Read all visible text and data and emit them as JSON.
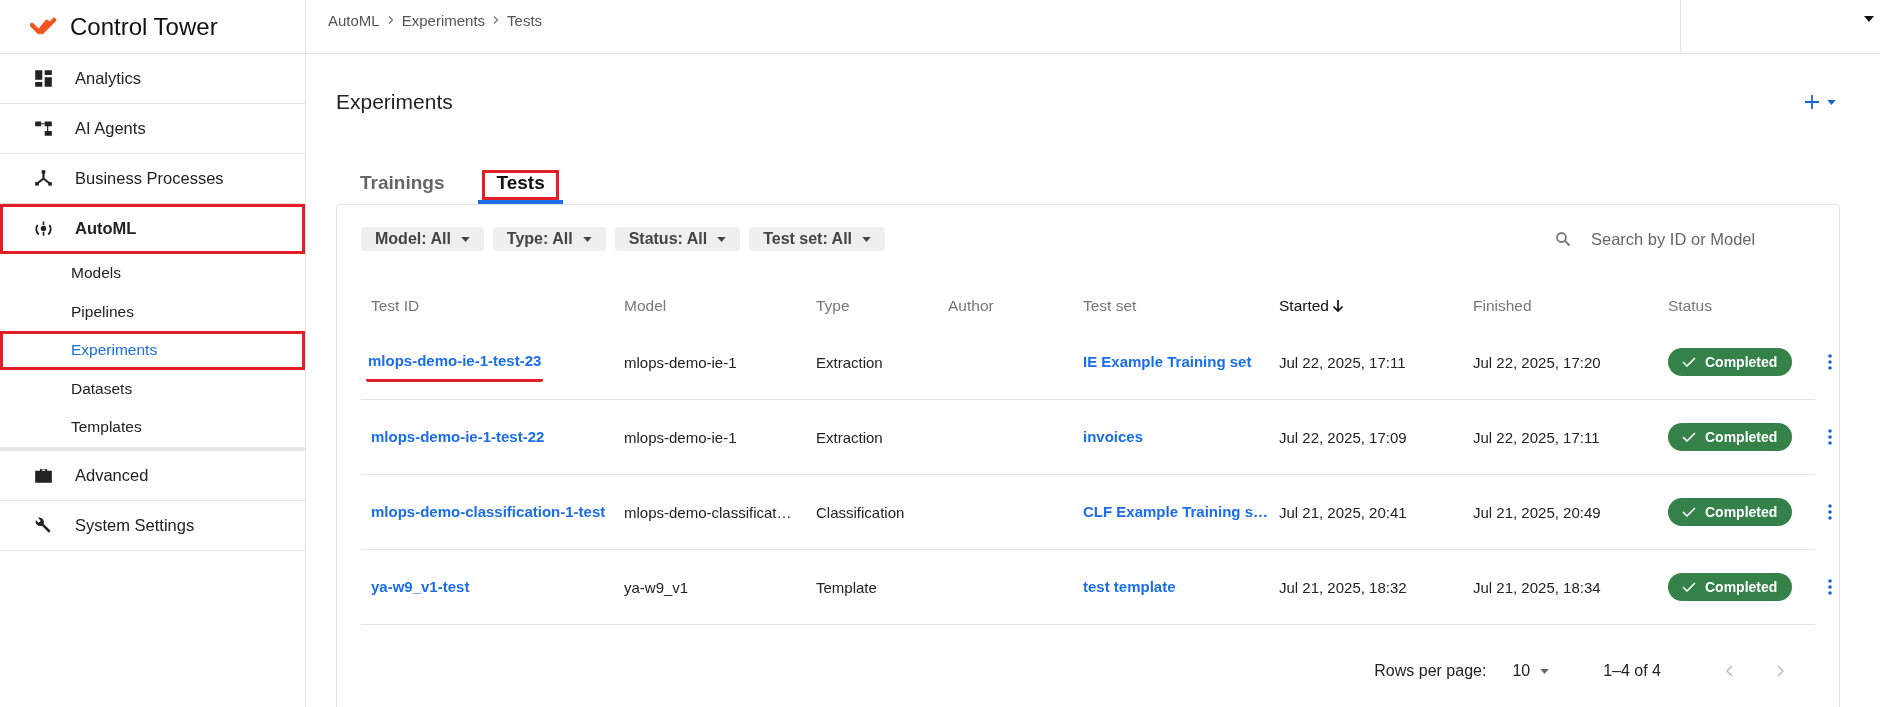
{
  "app": {
    "title": "Control Tower"
  },
  "sidebar": {
    "items": [
      {
        "label": "Analytics",
        "selected": false,
        "highlighted": false
      },
      {
        "label": "AI Agents",
        "selected": false,
        "highlighted": false
      },
      {
        "label": "Business Processes",
        "selected": false,
        "highlighted": false
      },
      {
        "label": "AutoML",
        "selected": true,
        "highlighted": true,
        "children": [
          {
            "label": "Models",
            "selected": false,
            "highlighted": false
          },
          {
            "label": "Pipelines",
            "selected": false,
            "highlighted": false
          },
          {
            "label": "Experiments",
            "selected": true,
            "highlighted": true
          },
          {
            "label": "Datasets",
            "selected": false,
            "highlighted": false
          },
          {
            "label": "Templates",
            "selected": false,
            "highlighted": false
          }
        ]
      },
      {
        "label": "Advanced",
        "selected": false,
        "highlighted": false
      },
      {
        "label": "System Settings",
        "selected": false,
        "highlighted": false
      }
    ]
  },
  "breadcrumbs": [
    "AutoML",
    "Experiments",
    "Tests"
  ],
  "page": {
    "title": "Experiments"
  },
  "tabs": [
    {
      "label": "Trainings",
      "selected": false,
      "highlighted": false
    },
    {
      "label": "Tests",
      "selected": true,
      "highlighted": true
    }
  ],
  "filters": [
    "Model: All",
    "Type: All",
    "Status: All",
    "Test set: All"
  ],
  "search": {
    "placeholder": "Search by ID or Model"
  },
  "table": {
    "columns": [
      {
        "label": "Test ID",
        "sorted": false
      },
      {
        "label": "Model",
        "sorted": false
      },
      {
        "label": "Type",
        "sorted": false
      },
      {
        "label": "Author",
        "sorted": false
      },
      {
        "label": "Test set",
        "sorted": false
      },
      {
        "label": "Started",
        "sorted": true
      },
      {
        "label": "Finished",
        "sorted": false
      },
      {
        "label": "Status",
        "sorted": false
      }
    ],
    "rows": [
      {
        "test_id": "mlops-demo-ie-1-test-23",
        "underlined": true,
        "model": "mlops-demo-ie-1",
        "type": "Extraction",
        "test_set": "IE Example Training set",
        "started": "Jul 22, 2025, 17:11",
        "finished": "Jul 22, 2025, 17:20",
        "status": "Completed"
      },
      {
        "test_id": "mlops-demo-ie-1-test-22",
        "underlined": false,
        "model": "mlops-demo-ie-1",
        "type": "Extraction",
        "test_set": "invoices",
        "started": "Jul 22, 2025, 17:09",
        "finished": "Jul 22, 2025, 17:11",
        "status": "Completed"
      },
      {
        "test_id": "mlops-demo-classification-1-test",
        "underlined": false,
        "model": "mlops-demo-classificat…",
        "type": "Classification",
        "test_set": "CLF Example Training s…",
        "started": "Jul 21, 2025, 20:41",
        "finished": "Jul 21, 2025, 20:49",
        "status": "Completed"
      },
      {
        "test_id": "ya-w9_v1-test",
        "underlined": false,
        "model": "ya-w9_v1",
        "type": "Template",
        "test_set": "test template",
        "started": "Jul 21, 2025, 18:32",
        "finished": "Jul 21, 2025, 18:34",
        "status": "Completed"
      }
    ]
  },
  "pagination": {
    "rows_label": "Rows per page:",
    "rows_value": "10",
    "range": "1–4 of 4"
  }
}
